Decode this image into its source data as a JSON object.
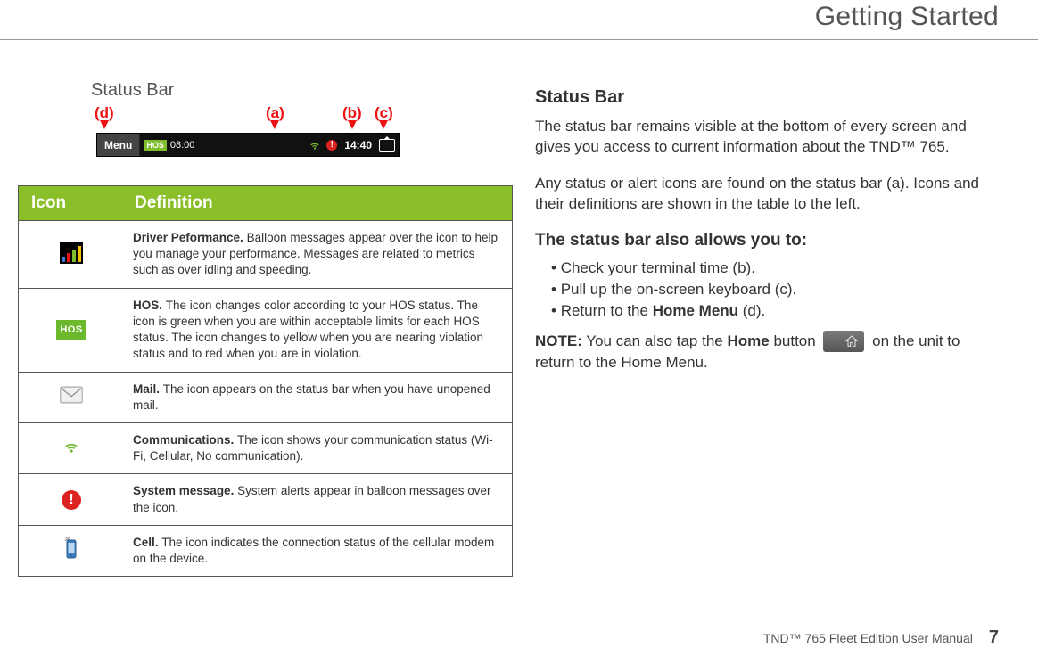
{
  "header": {
    "section_title": "Getting Started"
  },
  "left": {
    "figure_caption": "Status Bar",
    "labels": {
      "a": "(a)",
      "b": "(b)",
      "c": "(c)",
      "d": "(d)"
    },
    "figure": {
      "menu": "Menu",
      "hos_badge": "HOS",
      "hos_time": "08:00",
      "clock": "14:40"
    },
    "table": {
      "header_icon": "Icon",
      "header_def": "Definition",
      "rows": [
        {
          "icon_name": "driver-performance-icon",
          "title": "Driver Peformance. ",
          "body": "Balloon messages appear over the icon to help you manage your performance. Messages are related to metrics such as over idling and speeding."
        },
        {
          "icon_name": "hos-icon",
          "title": "HOS. ",
          "body": "The icon changes color according to your HOS status. The icon is green when you are within acceptable limits for each HOS status. The icon changes to yellow when you are nearing violation status and to red when you are in violation."
        },
        {
          "icon_name": "mail-icon",
          "title": "Mail. ",
          "body": "The icon appears on the status bar when you have unopened mail."
        },
        {
          "icon_name": "communications-icon",
          "title": "Communications. ",
          "body": "The icon shows your communication status (Wi-Fi, Cellular, No communication)."
        },
        {
          "icon_name": "system-message-icon",
          "title": "System message. ",
          "body": "System alerts appear in balloon messages over the icon."
        },
        {
          "icon_name": "cell-icon",
          "title": "Cell. ",
          "body": "The icon indicates the connection status of the cellular modem on the device."
        }
      ]
    }
  },
  "right": {
    "h2": "Status Bar",
    "p1": "The status bar remains visible at the bottom of every screen and gives you access to current information about the TND™ 765.",
    "p2": "Any status or alert icons are found on the status bar (a). Icons and their definitions are shown in the table to the left.",
    "h3": "The status bar also allows you to:",
    "bullets": [
      "Check your terminal time (b).",
      "Pull up the on-screen keyboard (c)."
    ],
    "bullet3_prefix": "Return to the ",
    "bullet3_bold": "Home Menu",
    "bullet3_suffix": " (d).",
    "note_label": "NOTE:",
    "note_prefix": " You can also tap the ",
    "note_bold": "Home",
    "note_mid": " button ",
    "note_suffix": "  on the unit to return to the Home Menu."
  },
  "footer": {
    "manual": "TND™ 765 Fleet Edition User Manual",
    "page": "7"
  }
}
